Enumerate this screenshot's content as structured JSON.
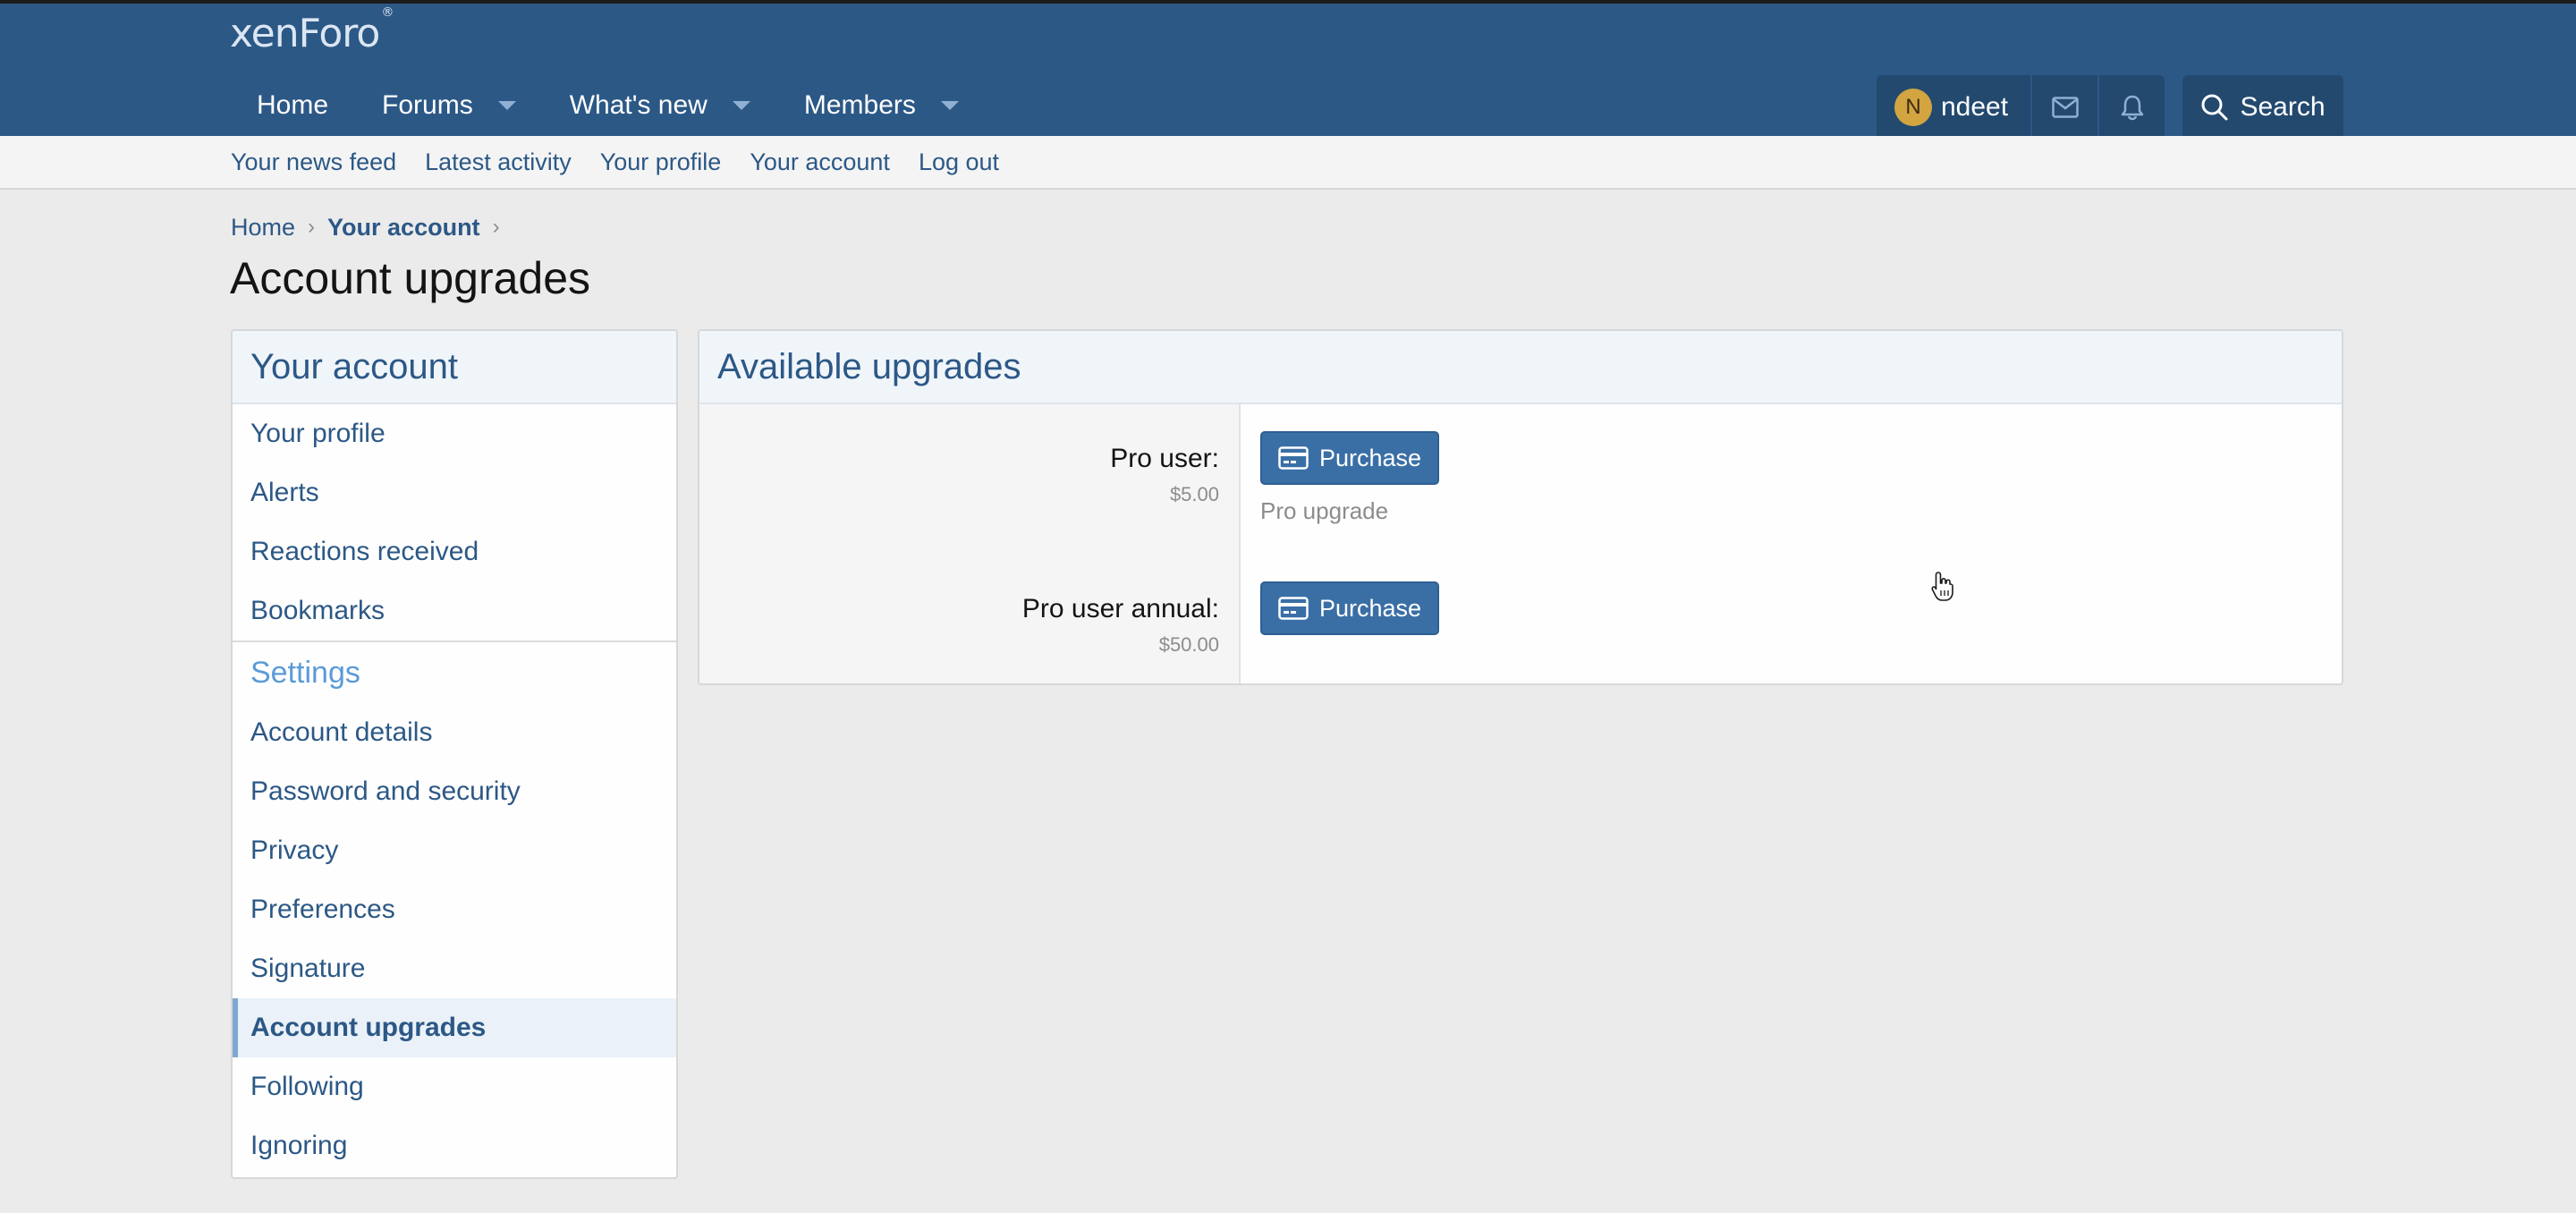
{
  "header": {
    "logo": "xenForo",
    "nav": [
      {
        "label": "Home",
        "caret": false
      },
      {
        "label": "Forums",
        "caret": true
      },
      {
        "label": "What's new",
        "caret": true
      },
      {
        "label": "Members",
        "caret": true
      }
    ],
    "user": {
      "initial": "N",
      "name": "ndeet"
    },
    "search_label": "Search"
  },
  "subnav": {
    "links": [
      "Your news feed",
      "Latest activity",
      "Your profile",
      "Your account",
      "Log out"
    ]
  },
  "breadcrumb": {
    "items": [
      "Home",
      "Your account"
    ]
  },
  "page_title": "Account upgrades",
  "sidebar": {
    "title": "Your account",
    "items": [
      "Your profile",
      "Alerts",
      "Reactions received",
      "Bookmarks"
    ],
    "settings_title": "Settings",
    "settings_items": [
      "Account details",
      "Password and security",
      "Privacy",
      "Preferences",
      "Signature",
      "Account upgrades",
      "Following",
      "Ignoring"
    ],
    "active": "Account upgrades"
  },
  "main": {
    "title": "Available upgrades",
    "upgrades": [
      {
        "name": "Pro user:",
        "price": "$5.00",
        "button": "Purchase",
        "description": "Pro upgrade"
      },
      {
        "name": "Pro user annual:",
        "price": "$50.00",
        "button": "Purchase",
        "description": ""
      }
    ]
  },
  "colors": {
    "header_bg": "#2c5886",
    "link": "#2c5886",
    "button": "#3a6fa6",
    "avatar": "#d2a541"
  }
}
